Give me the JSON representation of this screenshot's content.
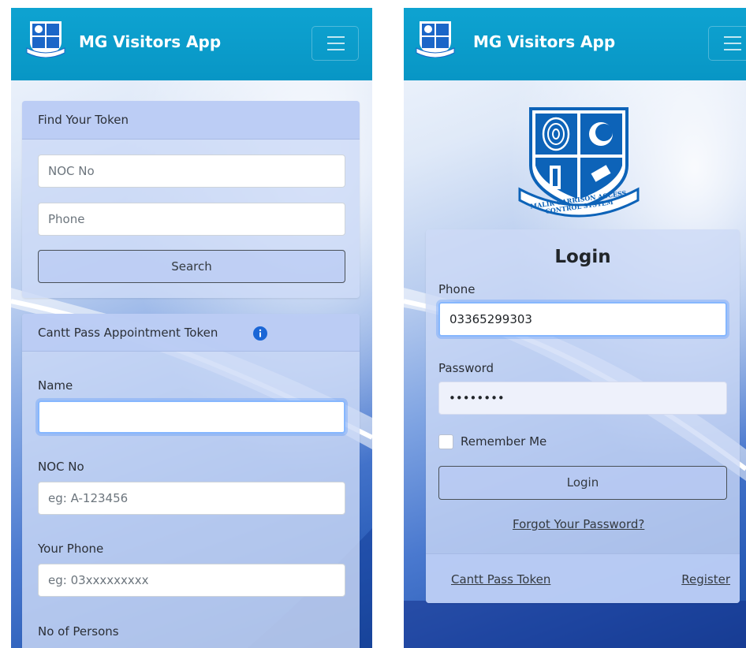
{
  "app": {
    "title": "MG Visitors App"
  },
  "find_token": {
    "header": "Find Your Token",
    "noc_placeholder": "NOC No",
    "phone_placeholder": "Phone",
    "search_label": "Search"
  },
  "appointment": {
    "header": "Cantt Pass Appointment Token",
    "info_icon": "info-circle-icon",
    "name_label": "Name",
    "name_value": "",
    "noc_label": "NOC No",
    "noc_placeholder": "eg: A-123456",
    "phone_label": "Your Phone",
    "phone_placeholder": "eg: 03xxxxxxxxx",
    "persons_label": "No of Persons"
  },
  "login": {
    "crest_text": "MALIR GARRISON ACCESS CONTROL SYSTEM",
    "title": "Login",
    "phone_label": "Phone",
    "phone_value": "03365299303",
    "password_label": "Password",
    "password_value": "12345678",
    "remember_label": "Remember Me",
    "remember_checked": false,
    "login_button": "Login",
    "forgot_link": "Forgot Your Password?",
    "cantt_link": "Cantt Pass Token",
    "register_link": "Register"
  },
  "colors": {
    "navbar": "#0ea3d1",
    "card": "#cddaf6",
    "info_icon": "#1a66d6",
    "crest_blue": "#0d63b8"
  }
}
